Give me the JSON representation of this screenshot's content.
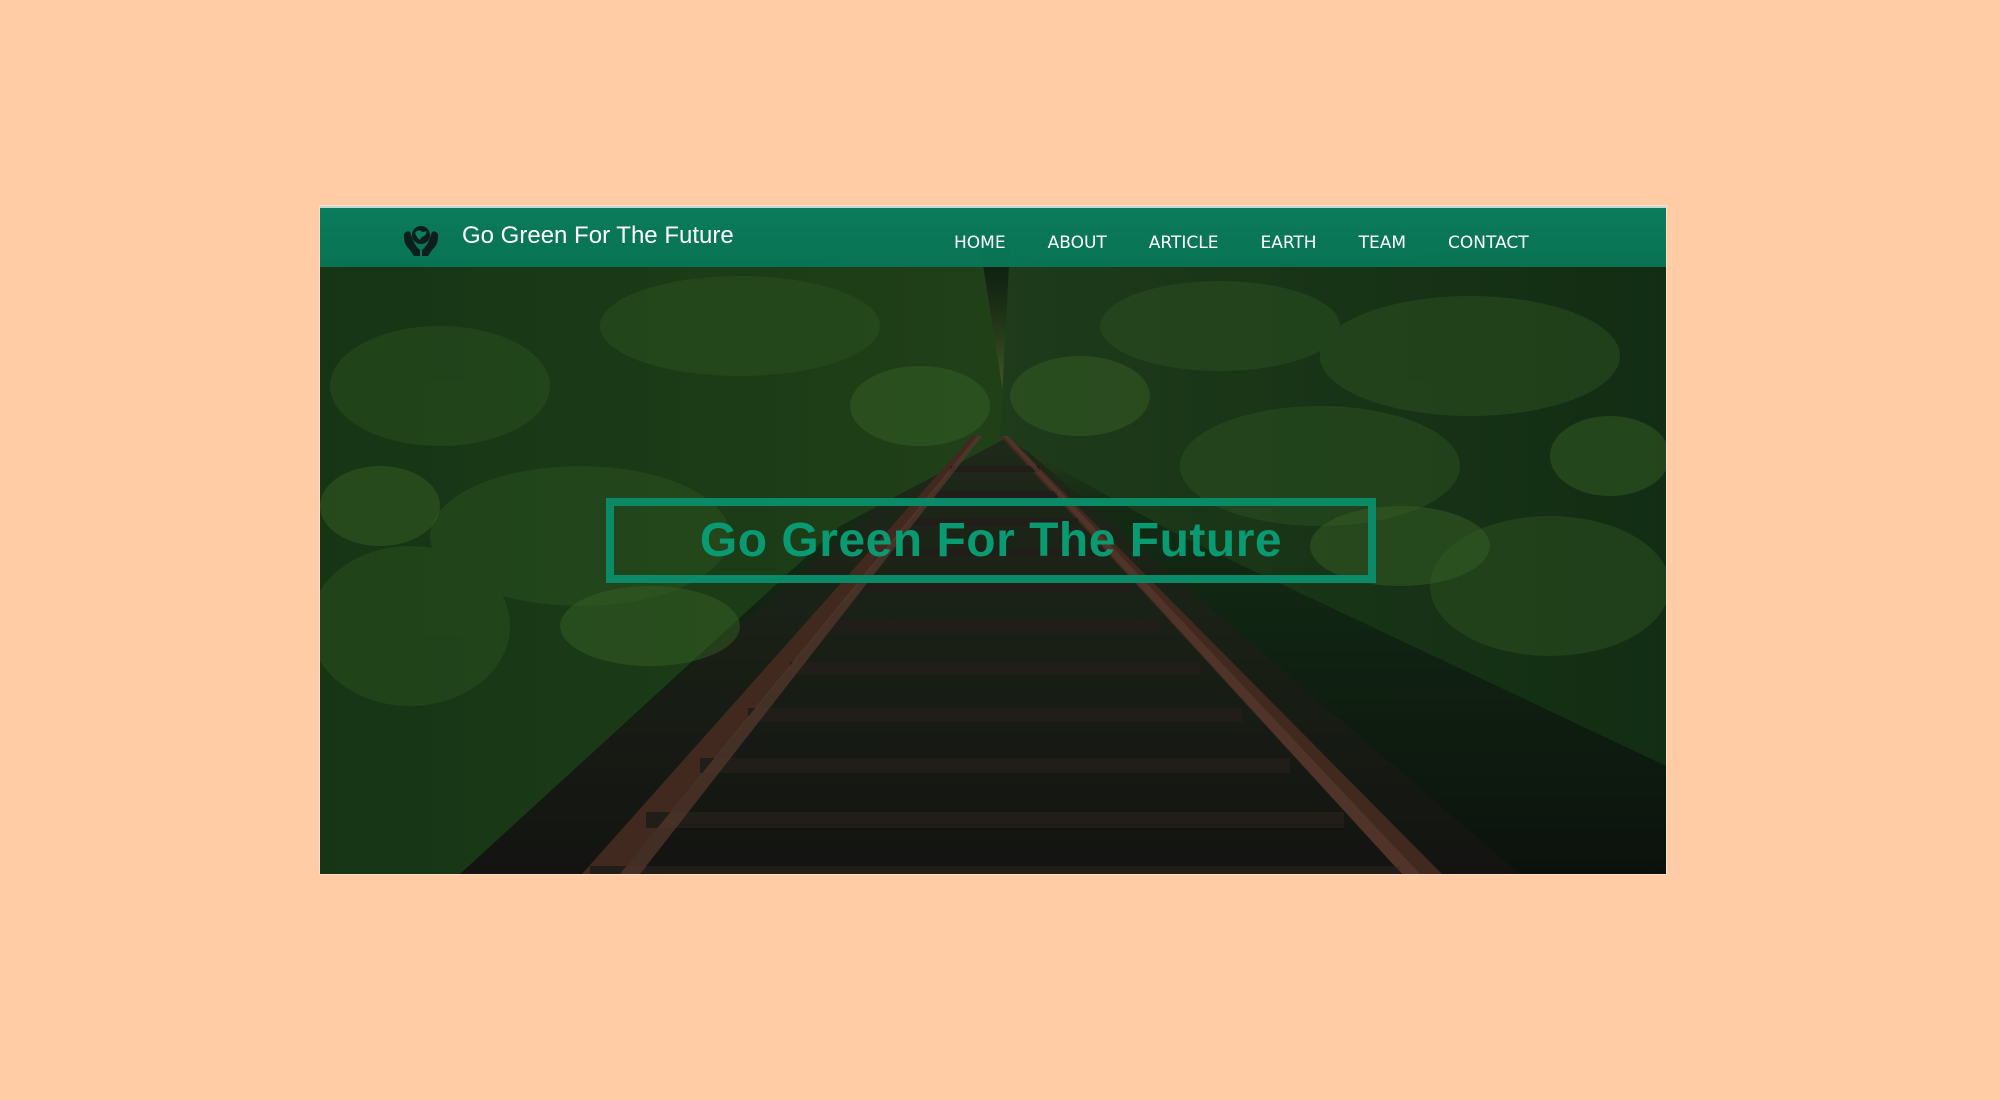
{
  "brand": {
    "title": "Go Green For The Future",
    "logo_icon": "hands-holding-earth-icon"
  },
  "nav": {
    "items": [
      {
        "label": "HOME"
      },
      {
        "label": "ABOUT"
      },
      {
        "label": "ARTICLE"
      },
      {
        "label": "EARTH"
      },
      {
        "label": "TEAM"
      },
      {
        "label": "CONTACT"
      }
    ]
  },
  "hero": {
    "title": "Go Green For The Future",
    "background": "railway-tracks-through-forest-photo"
  },
  "colors": {
    "page_background": "#ffcca6",
    "navbar": "#0a8260",
    "accent_green": "#0a8a66",
    "nav_text": "#ffffff"
  }
}
